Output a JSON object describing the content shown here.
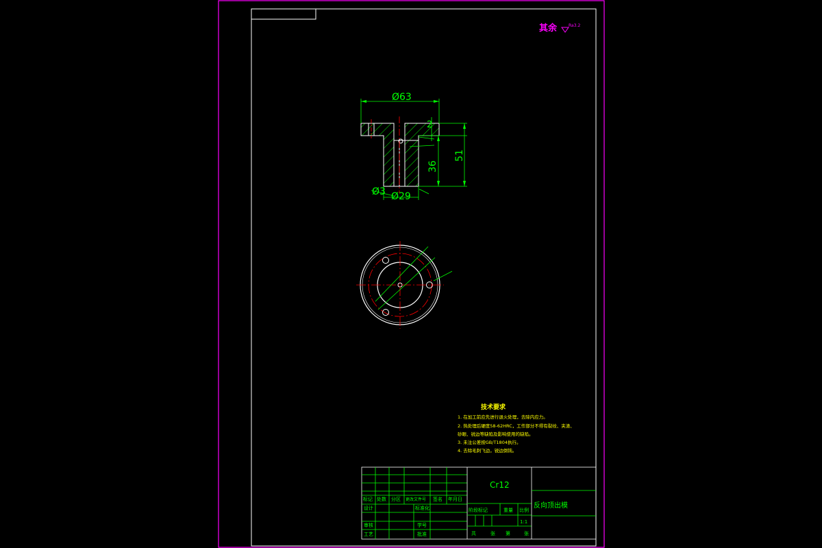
{
  "surface_note": {
    "label": "其余",
    "symbol": "Ra3.2"
  },
  "dimensions": {
    "flange_diameter": "Ø63",
    "flange_thickness": "2",
    "inner_depth": "36",
    "total_height": "51",
    "bore_diameter": "Ø29",
    "small_diameter": "Ø3"
  },
  "tech_requirements": {
    "title": "技术要求",
    "items": [
      "1. 在加工前应先进行退火处理，去除内应力。",
      "2. 热处理后硬度58-62HRC，工作部分不得有裂纹、夹渣、",
      "   砂眼、锐边等缺陷及影响使用的缺陷。",
      "3. 未注公差按GB/T1804执行。",
      "4. 去除毛刺飞边，锐边倒钝。"
    ]
  },
  "title_block": {
    "material": "Cr12",
    "part_name": "反向顶出模",
    "scale": "1:1",
    "headers": [
      "标记",
      "处数",
      "分区",
      "更改文件号",
      "签名",
      "年月日"
    ],
    "roles": [
      "设计",
      "标准化",
      "审核",
      "学号",
      "工艺",
      "批准"
    ],
    "stage_headers": [
      "阶段标记",
      "重量",
      "比例"
    ],
    "sheet_info": [
      "共",
      "张",
      "第",
      "张"
    ]
  },
  "colors": {
    "border": "#ff00ff",
    "line": "#ffffff",
    "dimension": "#00ff00",
    "center_line": "#ff0000",
    "note": "#ffff00",
    "hatch": "#00ff00"
  }
}
